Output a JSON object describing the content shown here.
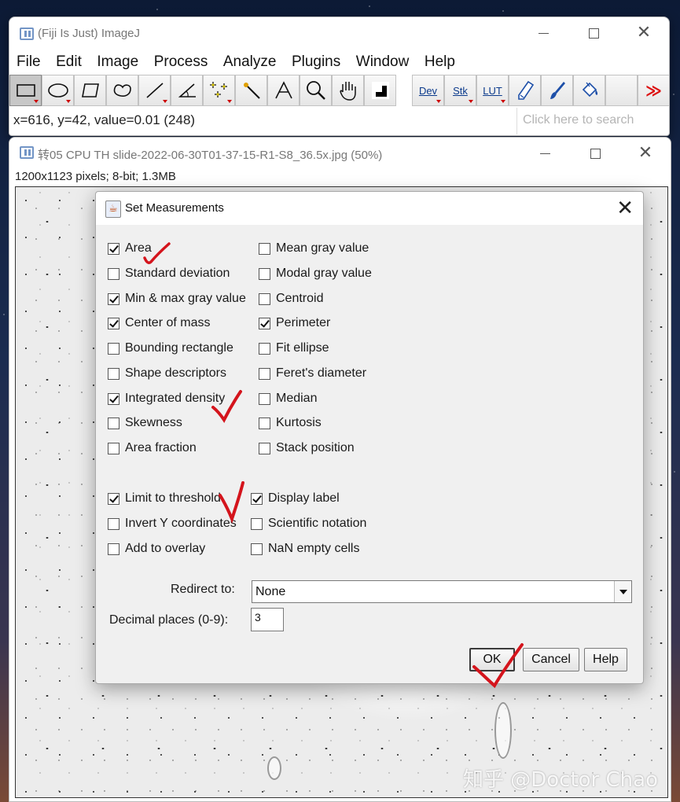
{
  "main_window": {
    "title": "(Fiji Is Just) ImageJ",
    "menus": [
      "File",
      "Edit",
      "Image",
      "Process",
      "Analyze",
      "Plugins",
      "Window",
      "Help"
    ],
    "tools": [
      {
        "icon": "rectangle-tool-icon"
      },
      {
        "icon": "oval-tool-icon"
      },
      {
        "icon": "polygon-tool-icon"
      },
      {
        "icon": "freehand-tool-icon"
      },
      {
        "icon": "straight-line-tool-icon"
      },
      {
        "icon": "angle-tool-icon"
      },
      {
        "icon": "multipoint-tool-icon"
      },
      {
        "icon": "wand-tool-icon"
      },
      {
        "icon": "text-tool-icon"
      },
      {
        "icon": "magnifier-tool-icon"
      },
      {
        "icon": "hand-tool-icon"
      },
      {
        "icon": "color-picker-tool-icon"
      },
      {
        "label": "Dev"
      },
      {
        "label": "Stk"
      },
      {
        "label": "LUT"
      },
      {
        "icon": "pencil-tool-icon"
      },
      {
        "icon": "brush-tool-icon"
      },
      {
        "icon": "flood-fill-tool-icon"
      },
      {
        "icon": "more-tools-icon"
      }
    ],
    "status": "x=616, y=42, value=0.01 (248)",
    "search_placeholder": "Click here to search"
  },
  "image_window": {
    "title": "转05 CPU TH slide-2022-06-30T01-37-15-R1-S8_36.5x.jpg (50%)",
    "info": "1200x1123 pixels; 8-bit; 1.3MB",
    "watermark": "知乎 @Doctor Chao"
  },
  "dialog": {
    "title": "Set Measurements",
    "checkboxes": [
      {
        "label": "Area",
        "checked": true
      },
      {
        "label": "Mean gray value",
        "checked": false
      },
      {
        "label": "Standard deviation",
        "checked": false
      },
      {
        "label": "Modal gray value",
        "checked": false
      },
      {
        "label": "Min & max gray value",
        "checked": true
      },
      {
        "label": "Centroid",
        "checked": false
      },
      {
        "label": "Center of mass",
        "checked": true
      },
      {
        "label": "Perimeter",
        "checked": true
      },
      {
        "label": "Bounding rectangle",
        "checked": false
      },
      {
        "label": "Fit ellipse",
        "checked": false
      },
      {
        "label": "Shape descriptors",
        "checked": false
      },
      {
        "label": "Feret's diameter",
        "checked": false
      },
      {
        "label": "Integrated density",
        "checked": true
      },
      {
        "label": "Median",
        "checked": false
      },
      {
        "label": "Skewness",
        "checked": false
      },
      {
        "label": "Kurtosis",
        "checked": false
      },
      {
        "label": "Area fraction",
        "checked": false
      },
      {
        "label": "Stack position",
        "checked": false
      }
    ],
    "options": [
      {
        "label": "Limit to threshold",
        "checked": true
      },
      {
        "label": "Display label",
        "checked": true
      },
      {
        "label": "Invert Y coordinates",
        "checked": false
      },
      {
        "label": "Scientific notation",
        "checked": false
      },
      {
        "label": "Add to overlay",
        "checked": false
      },
      {
        "label": "NaN empty cells",
        "checked": false
      }
    ],
    "redirect_label": "Redirect to:",
    "redirect_value": "None",
    "decimal_label": "Decimal places (0-9):",
    "decimal_value": "3",
    "ok": "OK",
    "cancel": "Cancel",
    "help": "Help"
  },
  "annotation_color": "#d4141c"
}
